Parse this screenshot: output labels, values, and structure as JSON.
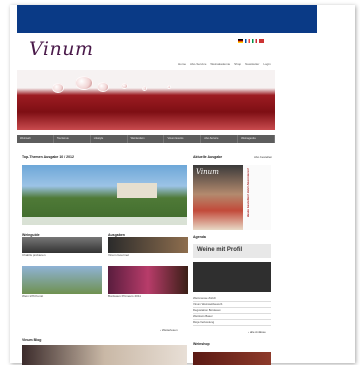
{
  "brand": {
    "name": "Vinum",
    "tagline": ""
  },
  "languages": [
    {
      "code": "de"
    },
    {
      "code": "fr"
    },
    {
      "code": "it"
    },
    {
      "code": "en"
    }
  ],
  "topnav": [
    "Home",
    "Abo-Service",
    "Weinakademie",
    "Shop",
    "Newsletter",
    "Login"
  ],
  "categories": [
    "Weinwelt",
    "Tourismus",
    "Lifestyle",
    "Weinlexikon",
    "Vinum Events",
    "Abo-Service",
    "Weinagenda"
  ],
  "main": {
    "section_title": "Top-Themen Ausgabe 10 / 2012",
    "hero_caption": "",
    "tiles": [
      {
        "heading": "Weinguide",
        "title": "Chablis probieren"
      },
      {
        "heading": "Ausgaben",
        "title": "Vinum Gourmet"
      },
      {
        "heading": "",
        "title": "Wein trifft Kunst"
      },
      {
        "heading": "",
        "title": "Bordeaux Primeurs 2011"
      }
    ],
    "more_label": "› Weiterlesen",
    "bottom_heading": "Vinum Blog"
  },
  "sidebar": {
    "heading": "Aktuelle Ausgabe",
    "more": "Abo bestellen",
    "magazine_title": "Vinum",
    "side_text": "Heute bestellen! Jetzt Abonnieren!",
    "subheading": "Weine mit Profil",
    "agenda_heading": "Agenda",
    "agenda_items": [
      "Weinmesse Zürich",
      "Vinum Weinwettbewerb",
      "Degustation Bordeaux",
      "Weinkurs Basel",
      "Rioja Verkostung"
    ],
    "more_agenda": "› alle Anlässe",
    "product_heading": "Weinshop"
  },
  "colors": {
    "accent": "#0a3a86",
    "wine": "#8e1b20",
    "nav": "#5d5d5d"
  }
}
